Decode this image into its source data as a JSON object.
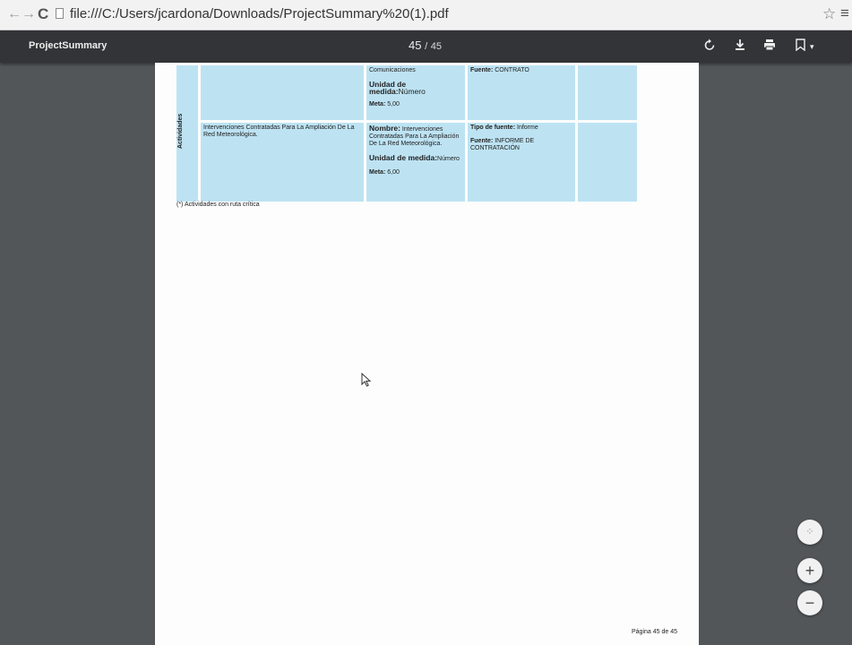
{
  "browser": {
    "url": "file:///C:/Users/jcardona/Downloads/ProjectSummary%20(1).pdf",
    "back_glyph": "←",
    "forward_glyph": "→",
    "reload_glyph": "C"
  },
  "toolbar": {
    "title": "ProjectSummary",
    "current_page": "45",
    "separator": "/",
    "total_pages": "45"
  },
  "table": {
    "row_label": "Actividades",
    "row1": {
      "indicator_top": "Comunicaciones",
      "unit_label": "Unidad de medida:",
      "unit_value": "Número",
      "meta_label": "Meta:",
      "meta_value": "5,00",
      "source_label": "Fuente:",
      "source_value": "CONTRATO"
    },
    "row2": {
      "activity": "Intervenciones Contratadas Para La Ampliación De La Red Meteorológica.",
      "name_label": "Nombre:",
      "name_value": "Intervenciones Contratadas Para La Ampliación De La Red Meteorológica.",
      "unit_label": "Unidad de medida:",
      "unit_value": "Número",
      "meta_label": "Meta:",
      "meta_value": "6,00",
      "source_type_label": "Tipo de fuente:",
      "source_type_value": "Informe",
      "source_label": "Fuente:",
      "source_value": "INFORME DE CONTRATACIÓN"
    }
  },
  "footnote": "(*) Actividades con ruta crítica",
  "page_footer": "Página 45 de 45"
}
